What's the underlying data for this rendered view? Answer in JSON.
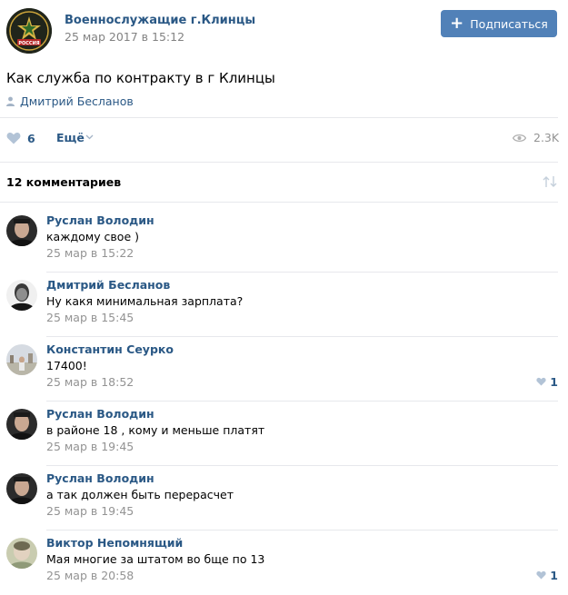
{
  "header": {
    "group_name": "Военнослужащие г.Клинцы",
    "date": "25 мар 2017 в 15:12",
    "subscribe_label": "Подписаться",
    "logo_text": "РОССИЯ"
  },
  "post": {
    "text": "Как служба по контракту в г Клинцы",
    "author": "Дмитрий Бесланов"
  },
  "actions": {
    "likes": "6",
    "more_label": "Ещё",
    "views": "2.3K"
  },
  "comments_count_label": "12 комментариев",
  "colors": {
    "link": "#2a5885",
    "button": "#5181b8",
    "muted": "#939393",
    "divider": "#e7e8ec"
  },
  "comments": [
    {
      "name": "Руслан Володин",
      "text": "каждому свое )",
      "date": "25 мар в 15:22",
      "likes": ""
    },
    {
      "name": "Дмитрий Бесланов",
      "text": "Ну какя минимальная зарплата?",
      "date": "25 мар в 15:45",
      "likes": ""
    },
    {
      "name": "Константин Сеурко",
      "text": "17400!",
      "date": "25 мар в 18:52",
      "likes": "1"
    },
    {
      "name": "Руслан Володин",
      "text": "в районе 18 , кому и меньше платят",
      "date": "25 мар в 19:45",
      "likes": ""
    },
    {
      "name": "Руслан Володин",
      "text": "а так должен быть перерасчет",
      "date": "25 мар в 19:45",
      "likes": ""
    },
    {
      "name": "Виктор Непомнящий",
      "text": "Мая многие за штатом во бще по 13",
      "date": "25 мар в 20:58",
      "likes": "1"
    }
  ]
}
